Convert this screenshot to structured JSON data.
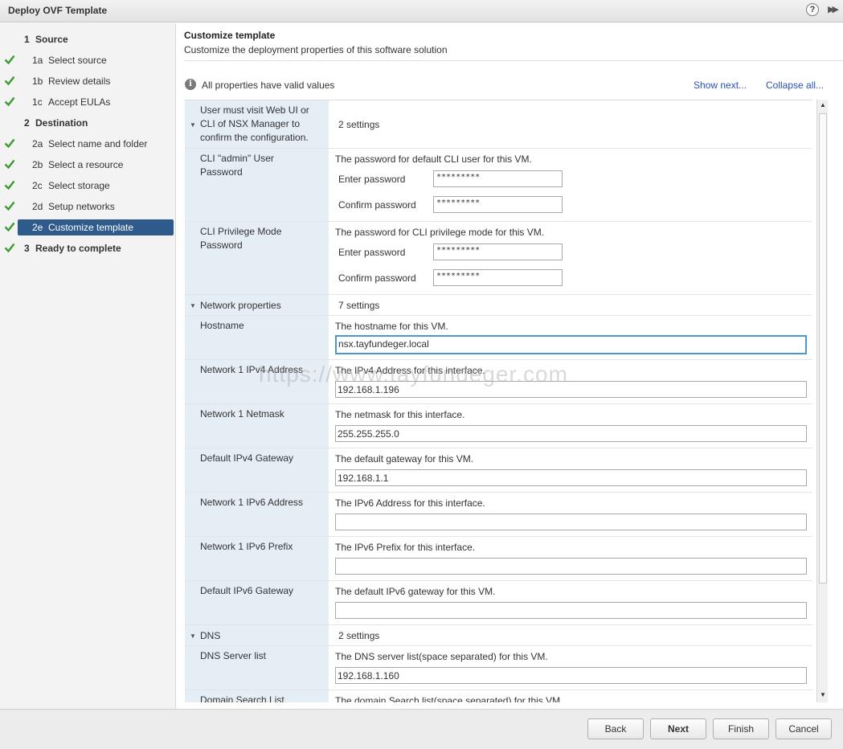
{
  "window": {
    "title": "Deploy OVF Template"
  },
  "icons": {
    "help": "?",
    "expand": "▶▶",
    "info": "i",
    "caret_down": "▼",
    "scroll_up": "▲",
    "scroll_down": "▼"
  },
  "colors": {
    "accent": "#2f5a8c",
    "check": "#3a9a2f",
    "link": "#2a4fb3",
    "focus": "#4a97d6"
  },
  "nav": [
    {
      "num": "1",
      "label": "Source"
    },
    {
      "num": "1a",
      "label": "Select source"
    },
    {
      "num": "1b",
      "label": "Review details"
    },
    {
      "num": "1c",
      "label": "Accept EULAs"
    },
    {
      "num": "2",
      "label": "Destination"
    },
    {
      "num": "2a",
      "label": "Select name and folder"
    },
    {
      "num": "2b",
      "label": "Select a resource"
    },
    {
      "num": "2c",
      "label": "Select storage"
    },
    {
      "num": "2d",
      "label": "Setup networks"
    },
    {
      "num": "2e",
      "label": "Customize template"
    },
    {
      "num": "3",
      "label": "Ready to complete"
    }
  ],
  "main": {
    "title": "Customize template",
    "subtitle": "Customize the deployment properties of this software solution",
    "valid_text": "All properties have valid values",
    "show_next": "Show next...",
    "collapse_all": "Collapse all..."
  },
  "groups": {
    "nsx": {
      "label": "User must visit Web UI or CLI of NSX Manager to confirm the configuration.",
      "count": "2 settings"
    },
    "network": {
      "label": "Network properties",
      "count": "7 settings"
    },
    "dns": {
      "label": "DNS",
      "count": "2 settings"
    }
  },
  "labels": {
    "enter_password": "Enter password",
    "confirm_password": "Confirm password"
  },
  "props": {
    "cli_admin": {
      "label": "CLI \"admin\" User Password",
      "desc": "The password for default CLI user for this VM.",
      "enter": "*********",
      "confirm": "*********"
    },
    "cli_priv": {
      "label": "CLI Privilege Mode Password",
      "desc": "The password for CLI privilege mode for this VM.",
      "enter": "*********",
      "confirm": "*********"
    },
    "hostname": {
      "label": "Hostname",
      "desc": "The hostname for this VM.",
      "value": "nsx.tayfundeger.local"
    },
    "ipv4": {
      "label": "Network 1 IPv4 Address",
      "desc": "The IPv4 Address for this interface.",
      "value": "192.168.1.196"
    },
    "netmask": {
      "label": "Network 1 Netmask",
      "desc": "The netmask for this interface.",
      "value": "255.255.255.0"
    },
    "gw4": {
      "label": "Default IPv4 Gateway",
      "desc": "The default gateway for this VM.",
      "value": "192.168.1.1"
    },
    "ipv6": {
      "label": "Network 1 IPv6 Address",
      "desc": "The IPv6 Address for this interface.",
      "value": ""
    },
    "prefix6": {
      "label": "Network 1 IPv6 Prefix",
      "desc": "The IPv6 Prefix for this interface.",
      "value": ""
    },
    "gw6": {
      "label": "Default IPv6 Gateway",
      "desc": "The default IPv6 gateway for this VM.",
      "value": ""
    },
    "dns_servers": {
      "label": "DNS Server list",
      "desc": "The DNS server list(space separated) for this VM.",
      "value": "192.168.1.160"
    },
    "domain_search": {
      "label": "Domain Search List",
      "desc": "The domain Search list(space separated) for this VM."
    }
  },
  "watermark": "https://www.tayfundeger.com",
  "buttons": {
    "back": "Back",
    "next": "Next",
    "finish": "Finish",
    "cancel": "Cancel"
  }
}
